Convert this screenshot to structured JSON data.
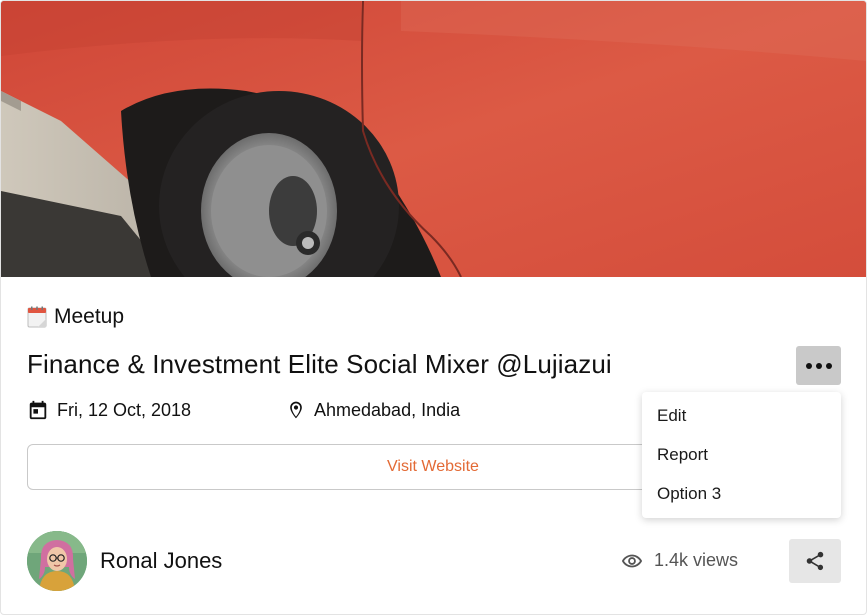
{
  "event": {
    "category_icon": "calendar-emoji-icon",
    "category": "Meetup",
    "title": "Finance & Investment Elite Social Mixer @Lujiazui",
    "date": "Fri, 12 Oct, 2018",
    "location": "Ahmedabad, India",
    "visit_label": "Visit Website"
  },
  "menu": {
    "icon": "more-horizontal-icon",
    "items": [
      "Edit",
      "Report",
      "Option 3"
    ]
  },
  "author": {
    "name": "Ronal Jones"
  },
  "stats": {
    "views": "1.4k views"
  },
  "colors": {
    "accent": "#e36a35",
    "car_red": "#d9533f",
    "more_button_bg": "#c9c9c9",
    "share_button_bg": "#e6e6e6"
  }
}
